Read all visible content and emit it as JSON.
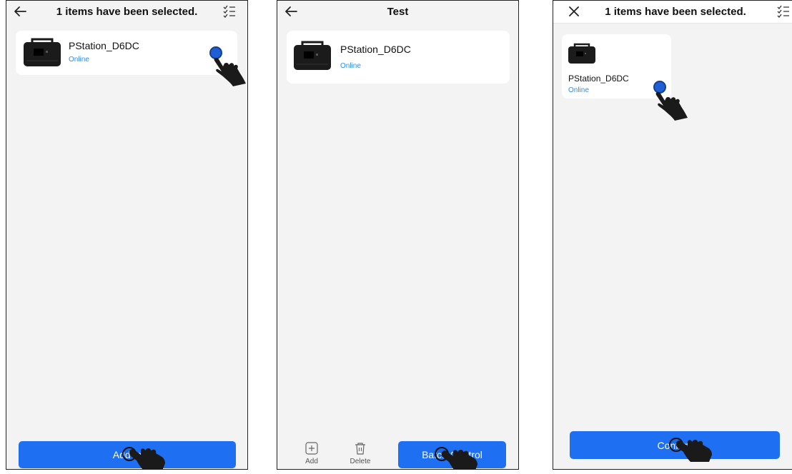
{
  "screens": [
    {
      "header": {
        "title": "1 items have been selected.",
        "left_icon": "back-arrow-icon",
        "right_icon": "checklist-icon"
      },
      "device": {
        "name": "PStation_D6DC",
        "status": "Online"
      },
      "primary_button": {
        "label": "Add to"
      }
    },
    {
      "header": {
        "title": "Test",
        "left_icon": "back-arrow-icon"
      },
      "device": {
        "name": "PStation_D6DC",
        "status": "Online"
      },
      "toolbar": {
        "add_label": "Add",
        "delete_label": "Delete"
      },
      "primary_button": {
        "label": "Batch Control"
      }
    },
    {
      "header": {
        "title": "1 items have been selected.",
        "left_icon": "close-icon",
        "right_icon": "checklist-icon"
      },
      "device": {
        "name": "PStation_D6DC",
        "status": "Online"
      },
      "primary_button": {
        "label": "Confirm"
      }
    }
  ],
  "colors": {
    "accent": "#1f6ff2",
    "status_online": "#2f8cf3",
    "background": "#f3f3f4",
    "card": "#ffffff"
  }
}
